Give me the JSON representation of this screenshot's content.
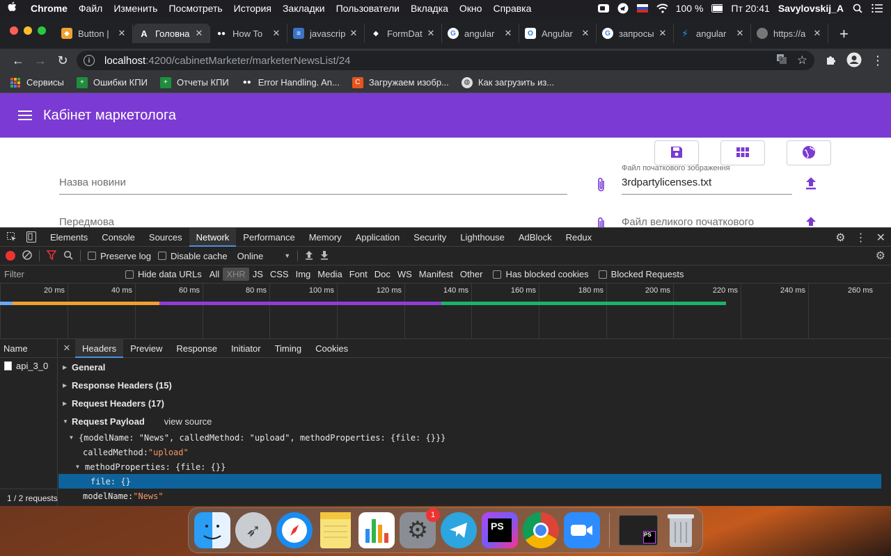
{
  "menubar": {
    "app": "Chrome",
    "items": [
      "Файл",
      "Изменить",
      "Посмотреть",
      "История",
      "Закладки",
      "Пользователи",
      "Вкладка",
      "Окно",
      "Справка"
    ],
    "battery": "100 %",
    "clock": "Пт 20:41",
    "user": "Savylovskij_A"
  },
  "tabs": [
    {
      "label": "Button |",
      "color": "#f0a030"
    },
    {
      "label": "Головна",
      "color": "#ffffff"
    },
    {
      "label": "How To",
      "color": "#ffffff"
    },
    {
      "label": "javascrip",
      "color": "#3b73c7"
    },
    {
      "label": "FormDat",
      "color": "#ffffff"
    },
    {
      "label": "angular",
      "color": "#4285f4"
    },
    {
      "label": "Angular",
      "color": "#2d79c7"
    },
    {
      "label": "запросы",
      "color": "#4285f4"
    },
    {
      "label": "angular",
      "color": "#2196f3"
    },
    {
      "label": "https://a",
      "color": "#777777"
    }
  ],
  "address": {
    "host": "localhost",
    "path": ":4200/cabinetMarketer/marketerNewsList/24"
  },
  "bookmarks": [
    {
      "label": "Сервисы",
      "color": "#e84a3c"
    },
    {
      "label": "Ошибки КПИ",
      "color": "#1e8e3e"
    },
    {
      "label": "Отчеты КПИ",
      "color": "#1e8e3e"
    },
    {
      "label": "Error Handling. An...",
      "color": "#ffffff"
    },
    {
      "label": "Загружаем изобр...",
      "color": "#e8541e"
    },
    {
      "label": "Как загрузить из...",
      "color": "#dddddd"
    }
  ],
  "page": {
    "title": "Кабінет маркетолога",
    "accent": "#7b3ad3",
    "news_title_placeholder": "Назва новини",
    "intro_placeholder": "Передмова",
    "start_image_label": "Файл початкового зображення",
    "start_image_value": "3rdpartylicenses.txt",
    "big_image_placeholder": "Файл великого початкового зображ..."
  },
  "devtools": {
    "tabs": [
      "Elements",
      "Console",
      "Sources",
      "Network",
      "Performance",
      "Memory",
      "Application",
      "Security",
      "Lighthouse",
      "AdBlock",
      "Redux"
    ],
    "active_tab": "Network",
    "preserve_log": "Preserve log",
    "disable_cache": "Disable cache",
    "throttle": "Online",
    "filter_placeholder": "Filter",
    "hide_data_urls": "Hide data URLs",
    "types": [
      "All",
      "XHR",
      "JS",
      "CSS",
      "Img",
      "Media",
      "Font",
      "Doc",
      "WS",
      "Manifest",
      "Other"
    ],
    "has_blocked_cookies": "Has blocked cookies",
    "blocked_requests": "Blocked Requests",
    "ticks": [
      "20 ms",
      "40 ms",
      "60 ms",
      "80 ms",
      "100 ms",
      "120 ms",
      "140 ms",
      "160 ms",
      "180 ms",
      "200 ms",
      "220 ms",
      "240 ms",
      "260 ms"
    ],
    "name_header": "Name",
    "request_name": "api_3_0",
    "status": "1 / 2 requests",
    "detail_tabs": [
      "Headers",
      "Preview",
      "Response",
      "Initiator",
      "Timing",
      "Cookies"
    ],
    "sections": {
      "general": "General",
      "response_headers": "Response Headers (15)",
      "request_headers": "Request Headers (17)",
      "payload": "Request Payload",
      "view_source": "view source"
    },
    "payload": {
      "summary": "{modelName: \"News\", calledMethod: \"upload\", methodProperties: {file: {}}}",
      "calledMethod_key": "calledMethod: ",
      "calledMethod_val": "\"upload\"",
      "methodProperties": "methodProperties: {file: {}}",
      "file": "file: {}",
      "modelName_key": "modelName: ",
      "modelName_val": "\"News\""
    }
  }
}
